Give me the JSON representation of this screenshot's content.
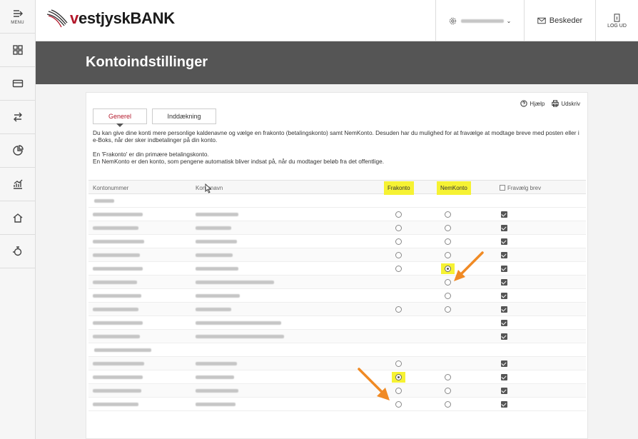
{
  "rail": {
    "menu_label": "MENU"
  },
  "header": {
    "logo_text_accent": "v",
    "logo_text": "estjyskBANK",
    "messages_label": "Beskeder",
    "logout_label": "LOG UD"
  },
  "hero": {
    "title": "Kontoindstillinger"
  },
  "tools": {
    "help": "Hjælp",
    "print": "Udskriv"
  },
  "tabs": [
    {
      "label": "Generel",
      "active": true
    },
    {
      "label": "Inddækning",
      "active": false
    }
  ],
  "intro": [
    "Du kan give dine konti mere personlige kaldenavne og vælge en frakonto (betalingskonto) samt NemKonto. Desuden har du mulighed for at fravælge at modtage breve med posten eller i e-Boks, når der sker indbetalinger på din konto.",
    "En 'Frakonto' er din primære betalingskonto.",
    "En NemKonto er den konto, som pengene automatisk bliver indsat på, når du modtager beløb fra det offentlige."
  ],
  "columns": {
    "account_number": "Kontonummer",
    "account_name": "Kontonavn",
    "frakonto": "Frakonto",
    "nemkonto": "NemKonto",
    "opt_out": "Fravælg brev"
  },
  "highlight_color": "#f6f233",
  "arrow_color": "#f08a24",
  "groups": [
    {
      "rows": [
        {
          "fra": "off",
          "nem": "off",
          "brev": true
        },
        {
          "fra": "off",
          "nem": "off",
          "brev": true
        },
        {
          "fra": "off",
          "nem": "off",
          "brev": true
        },
        {
          "fra": "off",
          "nem": "off",
          "brev": true
        },
        {
          "fra": "off",
          "nem": "on",
          "brev": true
        },
        {
          "fra": "none",
          "nem": "off",
          "brev": true
        },
        {
          "fra": "none",
          "nem": "off",
          "brev": true
        },
        {
          "fra": "off",
          "nem": "off",
          "brev": true
        },
        {
          "fra": "none",
          "nem": "none",
          "brev": true
        },
        {
          "fra": "none",
          "nem": "none",
          "brev": true
        }
      ]
    },
    {
      "rows": [
        {
          "fra": "off",
          "nem": "none",
          "brev": true
        },
        {
          "fra": "on",
          "nem": "off",
          "brev": true
        },
        {
          "fra": "off",
          "nem": "off",
          "brev": true
        },
        {
          "fra": "off",
          "nem": "off",
          "brev": true
        }
      ]
    }
  ]
}
